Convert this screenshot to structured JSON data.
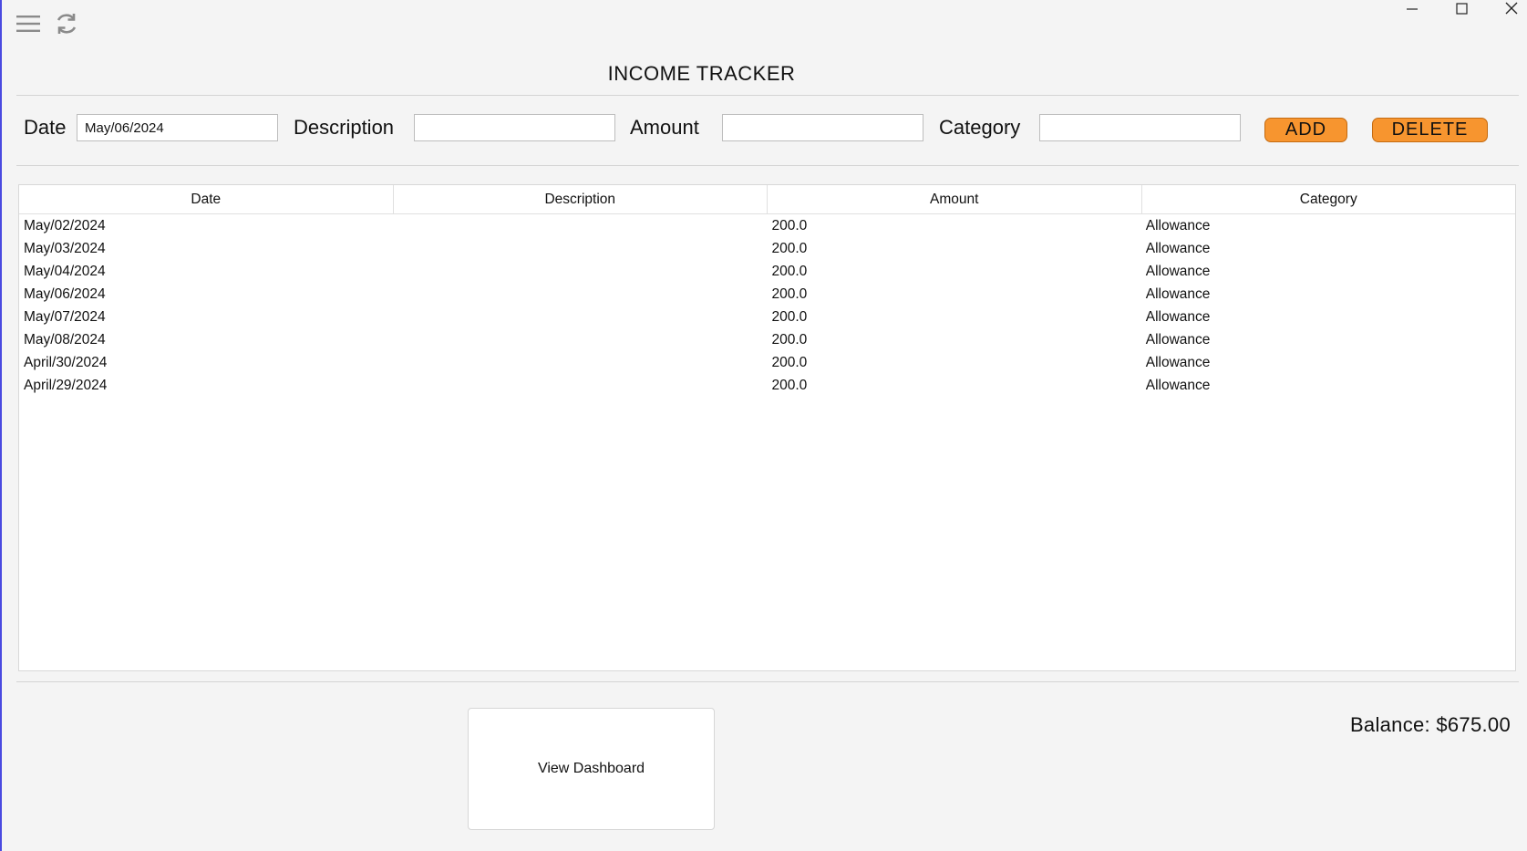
{
  "toolbar": {
    "menu_icon": "hamburger-menu-icon",
    "refresh_icon": "refresh-icon"
  },
  "window_controls": {
    "minimize": "minimize-icon",
    "maximize": "maximize-icon",
    "close": "close-icon"
  },
  "title": "INCOME TRACKER",
  "form": {
    "date_label": "Date",
    "date_value": "May/06/2024",
    "description_label": "Description",
    "description_value": "",
    "amount_label": "Amount",
    "amount_value": "",
    "category_label": "Category",
    "category_value": "",
    "add_label": "ADD",
    "delete_label": "DELETE"
  },
  "table": {
    "columns": [
      "Date",
      "Description",
      "Amount",
      "Category"
    ],
    "rows": [
      [
        "May/02/2024",
        "",
        "200.0",
        "Allowance"
      ],
      [
        "May/03/2024",
        "",
        "200.0",
        "Allowance"
      ],
      [
        "May/04/2024",
        "",
        "200.0",
        "Allowance"
      ],
      [
        "May/06/2024",
        "",
        "200.0",
        "Allowance"
      ],
      [
        "May/07/2024",
        "",
        "200.0",
        "Allowance"
      ],
      [
        "May/08/2024",
        "",
        "200.0",
        "Allowance"
      ],
      [
        "April/30/2024",
        "",
        "200.0",
        "Allowance"
      ],
      [
        "April/29/2024",
        "",
        "200.0",
        "Allowance"
      ]
    ]
  },
  "dashboard_button": "View Dashboard",
  "balance": "Balance: $675.00",
  "colors": {
    "accent": "#f7952f",
    "window_border": "#4a4ae0"
  }
}
